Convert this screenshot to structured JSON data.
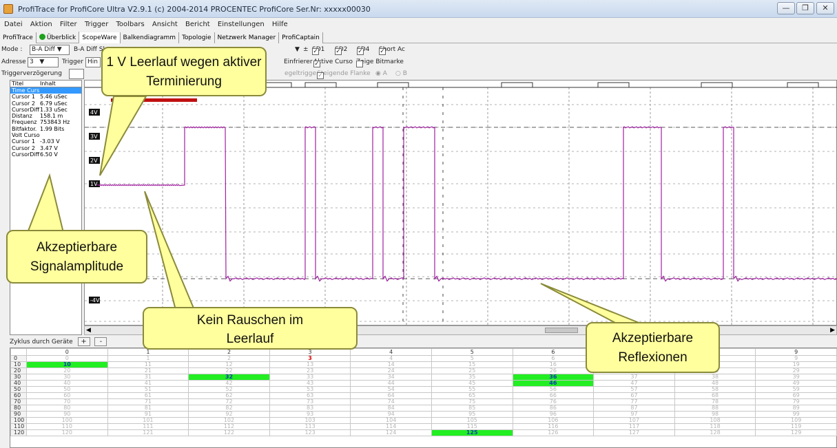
{
  "window": {
    "title": "ProfiTrace for ProfiCore Ultra V2.9.1 (c) 2004-2014 PROCENTEC  ProfiCore Ser.Nr: xxxxx00030"
  },
  "menu": [
    "Datei",
    "Aktion",
    "Filter",
    "Trigger",
    "Toolbars",
    "Ansicht",
    "Bericht",
    "Einstellungen",
    "Hilfe"
  ],
  "tabs": [
    "ProfiTrace",
    "Überblick",
    "ScopeWare",
    "Balkendiagramm",
    "Topologie",
    "Netzwerk Manager",
    "ProfiCaptain"
  ],
  "toolbar1": {
    "mode_label": "Mode :",
    "mode_value": "B-A Diff",
    "bad_label": "B-A Diff Sk",
    "sd1": "SD1",
    "sd2": "SD2",
    "sd4": "SD4",
    "short": "Short Ac"
  },
  "toolbar2": {
    "adresse_label": "Adresse",
    "adresse_value": "3",
    "trigger_label": "Trigger",
    "trigger_value": "Hin",
    "einfrierer": "Einfrierer",
    "aktive_curso": "Aktive Curso",
    "zeige_bitmarke": "Zeige Bitmarke"
  },
  "toolbar3": {
    "triggerverz": "Triggerverzögerung",
    "regeltrigger": "egeltrigge",
    "steigende": "Steigende Flanke",
    "a": "A",
    "b": "B"
  },
  "cursor_panel": {
    "headers": [
      "Titel",
      "Inhalt"
    ],
    "rows": [
      [
        "Time Curs",
        ""
      ],
      [
        "Cursor 1",
        "5.46 uSec"
      ],
      [
        "Cursor 2",
        "6.79 uSec"
      ],
      [
        "CursorDiff",
        "1.33 uSec"
      ],
      [
        "Distanz",
        "158.1 m"
      ],
      [
        "Frequenz",
        "753843 Hz"
      ],
      [
        "Bitfaktor.",
        "1.99 Bits"
      ],
      [
        "Volt Curso",
        ""
      ],
      [
        "Cursor 1",
        "-3.03 V"
      ],
      [
        "Cursor 2",
        "3.47 V"
      ],
      [
        "CursorDiff",
        "6.50 V"
      ]
    ]
  },
  "scope": {
    "y_labels": [
      "4V",
      "3V",
      "2V",
      "1V",
      "-4V"
    ],
    "trace_color": "#a020a0"
  },
  "zyklus": {
    "label": "Zyklus durch Geräte",
    "plus": "+",
    "minus": "-"
  },
  "grid": {
    "columns": [
      "0",
      "1",
      "2",
      "3",
      "4",
      "5",
      "6",
      "7",
      "8",
      "9"
    ],
    "row_labels": [
      "0",
      "10",
      "20",
      "30",
      "40",
      "50",
      "60",
      "70",
      "80",
      "90",
      "100",
      "110",
      "120"
    ],
    "active": [
      10,
      32,
      36,
      46,
      125
    ],
    "alert": [
      3
    ]
  },
  "callouts": {
    "leerlauf": "1 V Leerlauf wegen aktiver Terminierung",
    "amplitude": "Akzeptierbare Signalamplitude",
    "rauschen": "Kein Rauschen im Leerlauf",
    "reflexionen": "Akzeptierbare Reflexionen"
  }
}
